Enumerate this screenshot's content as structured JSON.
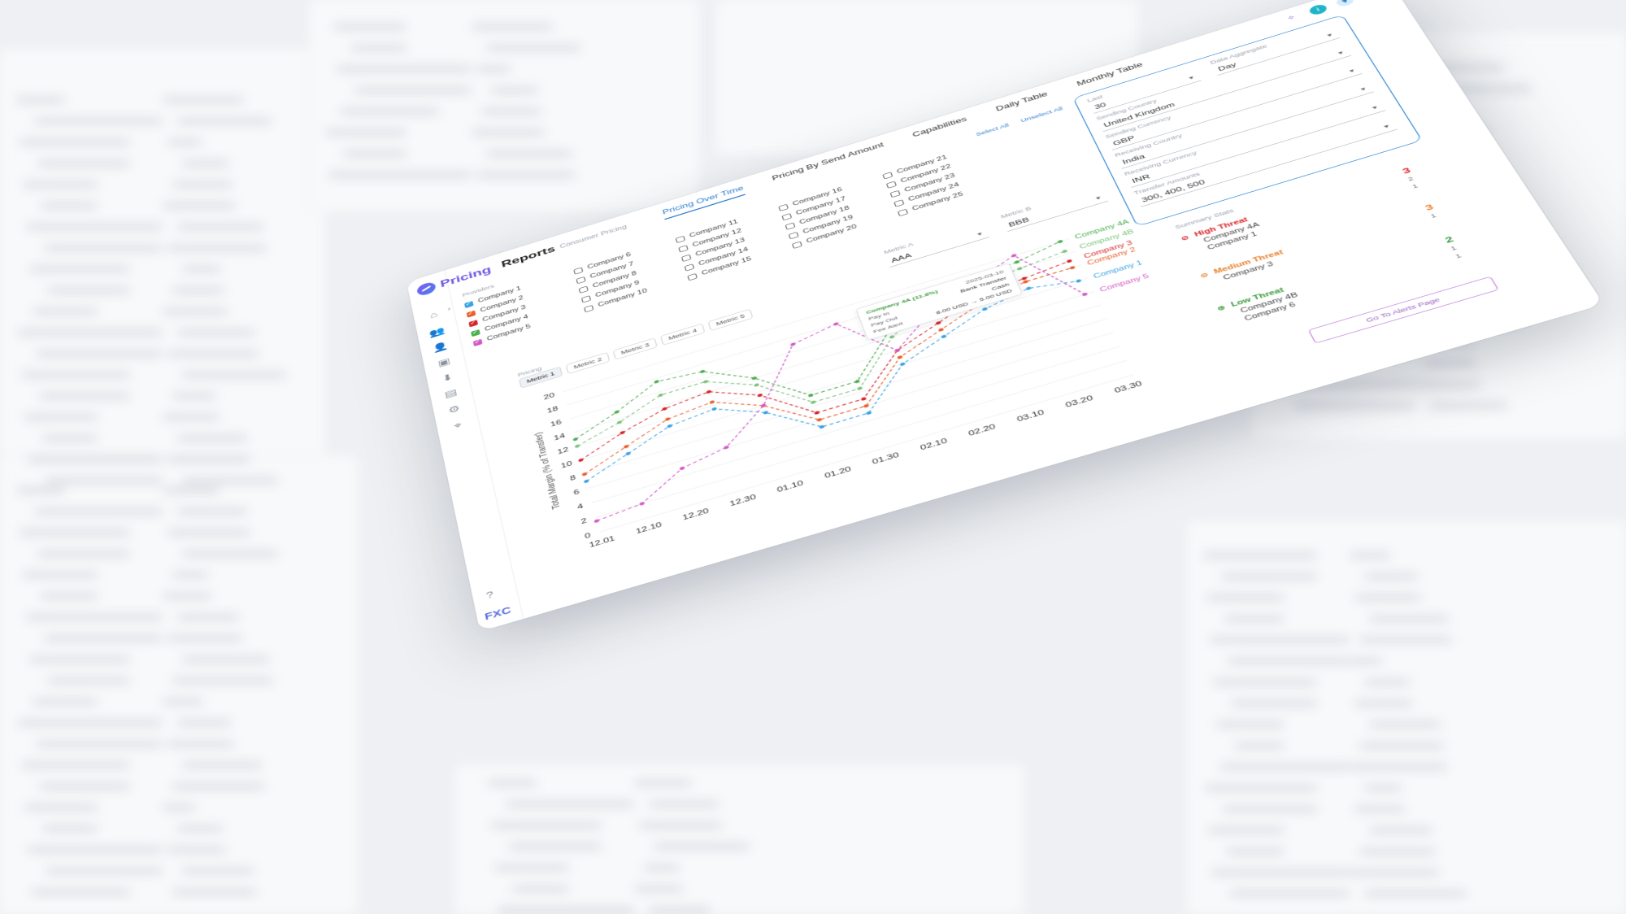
{
  "app": {
    "logo_text": "Pricing",
    "footer_logo": "FXC",
    "report_title": "Reports",
    "report_subtitle": "Consumer Pricing",
    "user_initials": "CI"
  },
  "tabs": [
    {
      "label": "Pricing Over Time",
      "active": true
    },
    {
      "label": "Pricing By Send Amount",
      "active": false
    },
    {
      "label": "Capabilities",
      "active": false
    },
    {
      "label": "Daily Table",
      "active": false
    },
    {
      "label": "Monthly Table",
      "active": false
    }
  ],
  "providers": {
    "label": "Providers",
    "select_all": "Select All",
    "unselect_all": "Unselect All",
    "columns": [
      [
        {
          "name": "Company 1",
          "checked": true,
          "color": "#3aa3e3"
        },
        {
          "name": "Company 2",
          "checked": true,
          "color": "#e8602c"
        },
        {
          "name": "Company 3",
          "checked": true,
          "color": "#d9252a"
        },
        {
          "name": "Company 4",
          "checked": true,
          "color": "#4caf50"
        },
        {
          "name": "Company 5",
          "checked": true,
          "color": "#d45ac8"
        }
      ],
      [
        {
          "name": "Company 6",
          "checked": false
        },
        {
          "name": "Company 7",
          "checked": false
        },
        {
          "name": "Company 8",
          "checked": false
        },
        {
          "name": "Company 9",
          "checked": false
        },
        {
          "name": "Company 10",
          "checked": false
        }
      ],
      [
        {
          "name": "Company 11",
          "checked": false
        },
        {
          "name": "Company 12",
          "checked": false
        },
        {
          "name": "Company 13",
          "checked": false
        },
        {
          "name": "Company 14",
          "checked": false
        },
        {
          "name": "Company 15",
          "checked": false
        }
      ],
      [
        {
          "name": "Company 16",
          "checked": false
        },
        {
          "name": "Company 17",
          "checked": false
        },
        {
          "name": "Company 18",
          "checked": false
        },
        {
          "name": "Company 19",
          "checked": false
        },
        {
          "name": "Company 20",
          "checked": false
        }
      ],
      [
        {
          "name": "Company 21",
          "checked": false
        },
        {
          "name": "Company 22",
          "checked": false
        },
        {
          "name": "Company 23",
          "checked": false
        },
        {
          "name": "Company 24",
          "checked": false
        },
        {
          "name": "Company 25",
          "checked": false
        }
      ]
    ]
  },
  "filters": {
    "last": {
      "label": "Last",
      "value": "30"
    },
    "data_aggregate": {
      "label": "Data Aggregate",
      "value": "Day"
    },
    "sending_country": {
      "label": "Sending Country",
      "value": "United Kingdom"
    },
    "sending_currency": {
      "label": "Sending Currency",
      "value": "GBP"
    },
    "receiving_country": {
      "label": "Receiving Country",
      "value": "India"
    },
    "receiving_currency": {
      "label": "Receiving Currency",
      "value": "INR"
    },
    "transfer_amounts": {
      "label": "Transfer Amounts",
      "value": "300, 400, 500"
    }
  },
  "metrics": {
    "metric_a": {
      "label": "Metric A",
      "value": "AAA"
    },
    "metric_b": {
      "label": "Metric B",
      "value": "BBB"
    },
    "pricing_label": "Pricing",
    "tabs": [
      "Metric 1",
      "Metric 2",
      "Metric 3",
      "Metric 4",
      "Metric 5"
    ]
  },
  "tooltip": {
    "title": "Company 4A (11.8%)",
    "date": "2025-03-10",
    "pay_in_label": "Pay In",
    "pay_in_value": "Bank Transfer",
    "pay_out_label": "Pay Out",
    "pay_out_value": "Cash",
    "fee_label": "Fee Alert",
    "fee_from": "8.00 USD",
    "fee_arrow": "→",
    "fee_to": "5.00 USD"
  },
  "chart_data": {
    "type": "line",
    "ylabel": "Total Margin (% of Transfer)",
    "ylim": [
      0,
      20
    ],
    "yticks": [
      0,
      2,
      4,
      6,
      8,
      10,
      12,
      14,
      16,
      18,
      20
    ],
    "categories": [
      "12.01",
      "12.10",
      "12.20",
      "12.30",
      "01.10",
      "01.20",
      "01.30",
      "02.10",
      "02.20",
      "03.10",
      "03.20",
      "03.30"
    ],
    "series": [
      {
        "name": "Company 4A",
        "color": "#4caf50",
        "values": [
          13,
          15,
          17.5,
          17,
          14,
          9.5,
          9.5,
          15,
          17,
          18.5,
          19,
          20
        ]
      },
      {
        "name": "Company 4B",
        "color": "#7cc47a",
        "values": [
          12,
          13.5,
          15.5,
          15.5,
          13,
          8.5,
          8.5,
          14,
          16.5,
          17.5,
          18,
          18.5
        ]
      },
      {
        "name": "Company 3",
        "color": "#d9252a",
        "values": [
          10,
          12,
          13.5,
          14,
          11.5,
          7,
          7,
          12,
          14,
          16,
          16.5,
          17
        ]
      },
      {
        "name": "Company 2",
        "color": "#e8602c",
        "values": [
          8,
          10,
          12,
          12.5,
          10,
          6,
          6,
          11,
          13,
          15,
          16,
          16
        ]
      },
      {
        "name": "Company 1",
        "color": "#3aa3e3",
        "values": [
          7,
          9,
          11,
          11.5,
          9,
          5,
          5,
          10,
          12,
          14,
          15,
          14
        ]
      },
      {
        "name": "Company 5",
        "color": "#d45ac8",
        "values": [
          1.5,
          2,
          5,
          6,
          10,
          17,
          18,
          12,
          16,
          18,
          20,
          12
        ]
      }
    ]
  },
  "summary": {
    "title": "Summary Stats",
    "groups": [
      {
        "level": "High Threat",
        "color": "#d9252a",
        "count": "3",
        "sub": [
          "2",
          "1"
        ],
        "companies": [
          "Company 4A",
          "Company 1"
        ]
      },
      {
        "level": "Medium Threat",
        "color": "#e8812c",
        "count": "3",
        "sub": [
          "1"
        ],
        "companies": [
          "Company 3"
        ]
      },
      {
        "level": "Low Threat",
        "color": "#3a9a3a",
        "count": "2",
        "sub": [
          "1",
          "1"
        ],
        "companies": [
          "Company 4B",
          "Company 6"
        ]
      }
    ],
    "button_label": "Go To Alerts Page"
  }
}
